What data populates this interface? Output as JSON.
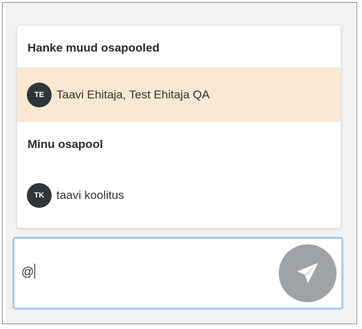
{
  "mention_dropdown": {
    "sections": [
      {
        "header": "Hanke muud osapooled",
        "items": [
          {
            "initials": "TE",
            "name": "Taavi Ehitaja, Test Ehitaja QA",
            "highlighted": true
          }
        ]
      },
      {
        "header": "Minu osapool",
        "items": [
          {
            "initials": "TK",
            "name": "taavi koolitus",
            "highlighted": false
          }
        ]
      }
    ]
  },
  "message_input": {
    "value": "@"
  },
  "send_button": {
    "icon": "paper-plane-icon"
  },
  "colors": {
    "highlight": "#fbe8d3",
    "avatar_bg": "#2f3538",
    "input_focus_border": "#a9cbe6",
    "send_button_bg": "#9fa3a6"
  }
}
